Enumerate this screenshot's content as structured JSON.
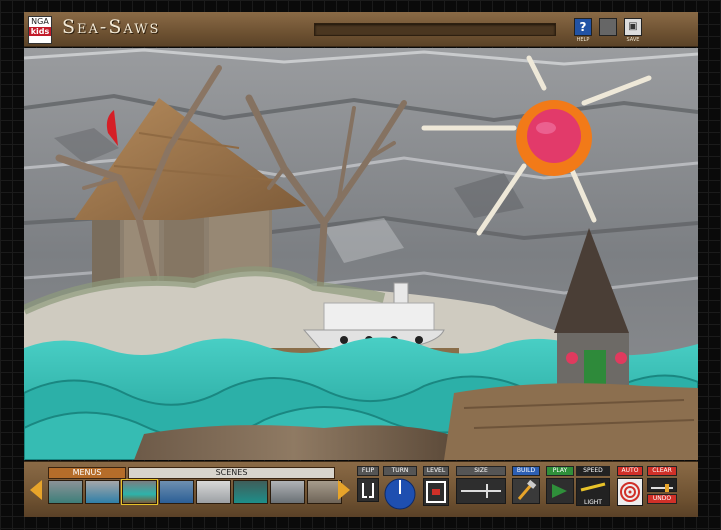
{
  "app": {
    "logo_top": "NGA",
    "logo_bottom": "kids",
    "title": "Sea-Saws",
    "help_label": "HELP",
    "save_label": "SAVE",
    "help_glyph": "?",
    "icons": {
      "help": "question-mark-icon",
      "save": "floppy-disk-icon",
      "blank": "blank-square-icon"
    }
  },
  "toolbar": {
    "menus_label": "MENUS",
    "scenes_label": "SCENES",
    "thumb_count": 8,
    "selected_thumb": 3,
    "tools": {
      "flip": "FLIP",
      "turn": "TURN",
      "level": "LEVEL",
      "size": "SIZE",
      "build": "BUILD",
      "play": "PLAY",
      "speed": "SPEED",
      "speed_slow": "",
      "speed_fast": "LIGHT",
      "auto": "AUTO",
      "clear": "CLEAR",
      "undo": "UNDO"
    }
  },
  "colors": {
    "wood": "#7a5b3a",
    "sea": "#2fb5ad",
    "sun_outer": "#f27a18",
    "sun_inner": "#e23a6a",
    "accent_orange": "#e7a42a",
    "scene_sel": "#e7c229",
    "help_blue": "#2253a5",
    "build_blue": "#2d5fb4",
    "play_green": "#2f8f3a",
    "auto_red": "#d03028"
  }
}
